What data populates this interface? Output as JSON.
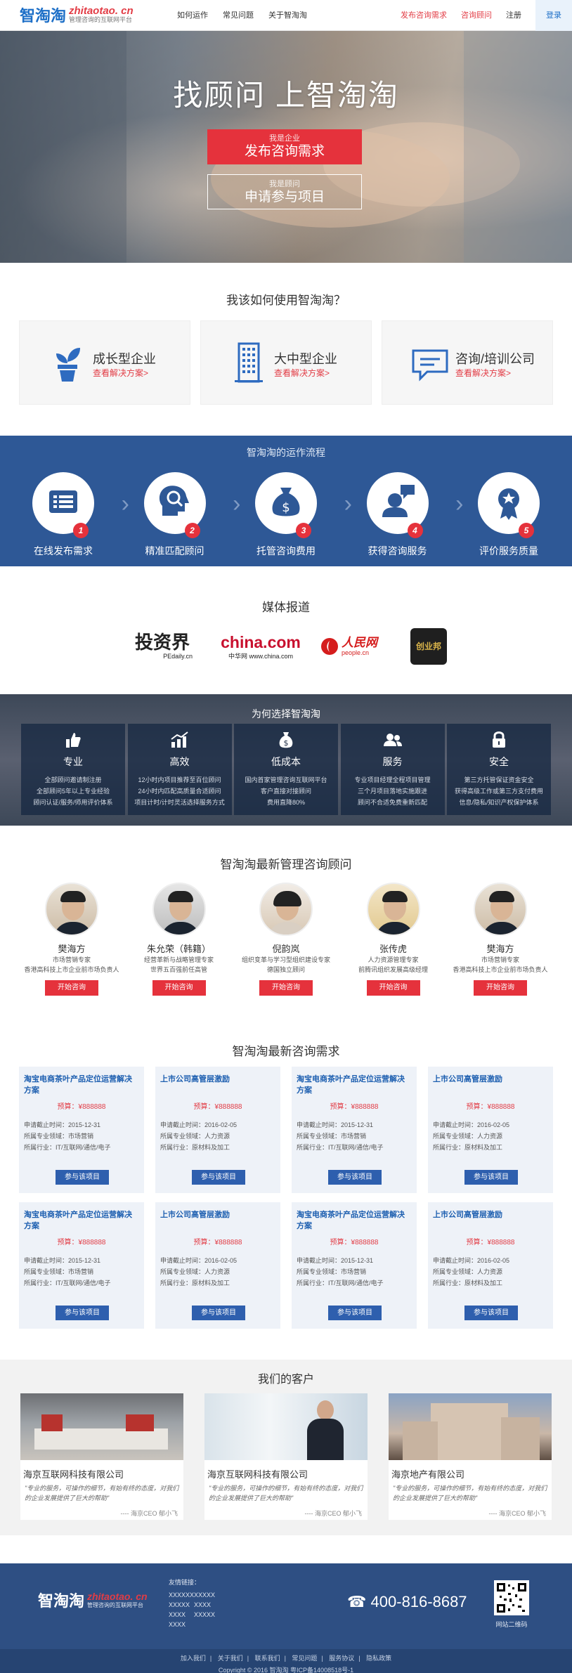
{
  "header": {
    "logo_cn": "智淘淘",
    "logo_url": "zhitaotao. cn",
    "logo_slogan": "管理咨询的互联网平台",
    "nav": [
      "如何运作",
      "常见问题",
      "关于智淘淘"
    ],
    "right_links": [
      "发布咨询需求",
      "咨询顾问",
      "注册"
    ],
    "login": "登录"
  },
  "hero": {
    "title": "找顾问  上智淘淘",
    "btn1_small": "我是企业",
    "btn1_large": "发布咨询需求",
    "btn2_small": "我是顾问",
    "btn2_large": "申请参与项目"
  },
  "usage": {
    "title": "我该如何使用智淘淘？",
    "cards": [
      {
        "title": "成长型企业",
        "link": "查看解决方案>",
        "icon": "plant-pot-icon"
      },
      {
        "title": "大中型企业",
        "link": "查看解决方案>",
        "icon": "building-icon"
      },
      {
        "title": "咨询/培训公司",
        "link": "查看解决方案>",
        "icon": "chat-bubble-icon"
      }
    ]
  },
  "flow": {
    "title": "智淘淘的运作流程",
    "steps": [
      {
        "label": "在线发布需求",
        "num": "1",
        "icon": "list-icon"
      },
      {
        "label": "精准匹配顾问",
        "num": "2",
        "icon": "head-search-icon"
      },
      {
        "label": "托管咨询费用",
        "num": "3",
        "icon": "money-bag-icon"
      },
      {
        "label": "获得咨询服务",
        "num": "4",
        "icon": "consultant-icon"
      },
      {
        "label": "评价服务质量",
        "num": "5",
        "icon": "award-icon"
      }
    ]
  },
  "media": {
    "title": "媒体报道",
    "logos": {
      "pedaily_main": "投资界",
      "pedaily_sub": "PEdaily.cn",
      "china_main": "china.com",
      "china_sub": "中华网  www.china.com",
      "people_main": "人民网",
      "people_sub": "people.cn",
      "chuangye": "创业邦"
    }
  },
  "why": {
    "title": "为何选择智淘淘",
    "items": [
      {
        "title": "专业",
        "lines": [
          "全部顾问邀请制注册",
          "全部顾问5年以上专业经验",
          "顾问认证/服务/师用评价体系"
        ],
        "icon": "thumb-up-icon"
      },
      {
        "title": "高效",
        "lines": [
          "12小时内项目推荐至百位顾问",
          "24小时内匹配高质量合适顾问",
          "项目计时/计时灵活选择服务方式"
        ],
        "icon": "chart-up-icon"
      },
      {
        "title": "低成本",
        "lines": [
          "国内首家管理咨询互联网平台",
          "客户直接对接顾问",
          "费用直降80%"
        ],
        "icon": "money-bag-icon"
      },
      {
        "title": "服务",
        "lines": [
          "专业项目经理全程项目管理",
          "三个月项目落地实施跟进",
          "顾问不合适免费重新匹配"
        ],
        "icon": "people-icon"
      },
      {
        "title": "安全",
        "lines": [
          "第三方托管保证资金安全",
          "获得高级工作或第三方支付费用",
          "信息/隐私/知识产权保护体系"
        ],
        "icon": "lock-icon"
      }
    ]
  },
  "consultants": {
    "title": "智淘淘最新管理咨询顾问",
    "items": [
      {
        "name": "樊海方",
        "r1": "市场营销专家",
        "r2": "香港高科技上市企业前市场负责人",
        "btn": "开始咨询"
      },
      {
        "name": "朱允荣（韩籍）",
        "r1": "经营革新与战略管理专家",
        "r2": "世界五百强前任高管",
        "btn": "开始咨询"
      },
      {
        "name": "倪韵岚",
        "r1": "组织变革与学习型组织建设专家",
        "r2": "德国独立顾问",
        "btn": "开始咨询"
      },
      {
        "name": "张传虎",
        "r1": "人力资源管理专家",
        "r2": "前腾讯组织发展高级经理",
        "btn": "开始咨询"
      },
      {
        "name": "樊海方",
        "r1": "市场营销专家",
        "r2": "香港高科技上市企业前市场负责人",
        "btn": "开始咨询"
      }
    ]
  },
  "demands": {
    "title": "智淘淘最新咨询需求",
    "items": [
      {
        "title": "淘宝电商茶叶产品定位运营解决方案",
        "budget": "预算：¥888888",
        "l1": "申请截止时间：2015-12-31",
        "l2": "所属专业领域：市场营销",
        "l3": "所属行业：IT/互联网/通信/电子",
        "btn": "参与该项目"
      },
      {
        "title": "上市公司高管层激励",
        "budget": "预算：¥888888",
        "l1": "申请截止时间：2016-02-05",
        "l2": "所属专业领域：人力资源",
        "l3": "所属行业：原材料及加工",
        "btn": "参与该项目"
      },
      {
        "title": "淘宝电商茶叶产品定位运营解决方案",
        "budget": "预算：¥888888",
        "l1": "申请截止时间：2015-12-31",
        "l2": "所属专业领域：市场营销",
        "l3": "所属行业：IT/互联网/通信/电子",
        "btn": "参与该项目"
      },
      {
        "title": "上市公司高管层激励",
        "budget": "预算：¥888888",
        "l1": "申请截止时间：2016-02-05",
        "l2": "所属专业领域：人力资源",
        "l3": "所属行业：原材料及加工",
        "btn": "参与该项目"
      },
      {
        "title": "淘宝电商茶叶产品定位运营解决方案",
        "budget": "预算：¥888888",
        "l1": "申请截止时间：2015-12-31",
        "l2": "所属专业领域：市场营销",
        "l3": "所属行业：IT/互联网/通信/电子",
        "btn": "参与该项目"
      },
      {
        "title": "上市公司高管层激励",
        "budget": "预算：¥888888",
        "l1": "申请截止时间：2016-02-05",
        "l2": "所属专业领域：人力资源",
        "l3": "所属行业：原材料及加工",
        "btn": "参与该项目"
      },
      {
        "title": "淘宝电商茶叶产品定位运营解决方案",
        "budget": "预算：¥888888",
        "l1": "申请截止时间：2015-12-31",
        "l2": "所属专业领域：市场营销",
        "l3": "所属行业：IT/互联网/通信/电子",
        "btn": "参与该项目"
      },
      {
        "title": "上市公司高管层激励",
        "budget": "预算：¥888888",
        "l1": "申请截止时间：2016-02-05",
        "l2": "所属专业领域：人力资源",
        "l3": "所属行业：原材料及加工",
        "btn": "参与该项目"
      }
    ]
  },
  "clients": {
    "title": "我们的客户",
    "items": [
      {
        "name": "海京互联网科技有限公司",
        "quote": "\"专业的服务，可操作的细节，有始有终的态度，对我们的企业发展提供了巨大的帮助\"",
        "sign": "---- 海京CEO  郁小飞"
      },
      {
        "name": "海京互联网科技有限公司",
        "quote": "\"专业的服务，可操作的细节，有始有终的态度，对我们的企业发展提供了巨大的帮助\"",
        "sign": "---- 海京CEO  郁小飞"
      },
      {
        "name": "海京地产有限公司",
        "quote": "\"专业的服务，可操作的细节，有始有终的态度，对我们的企业发展提供了巨大的帮助\"",
        "sign": "---- 海京CEO  郁小飞"
      }
    ]
  },
  "footer": {
    "logo_cn": "智淘淘",
    "logo_url": "zhitaotao. cn",
    "logo_slogan": "管理咨询的互联网平台",
    "links_title": "友情链接：",
    "links": [
      "XXXXXX",
      "XXXXX",
      "XXXXX",
      "XXXX",
      "XXXX",
      "XXXXX",
      "XXXX"
    ],
    "phone": "400-816-8687",
    "qr_label": "网站二维码",
    "bottom_links": [
      "加入我们",
      "关于我们",
      "联系我们",
      "常见问题",
      "服务协议",
      "隐私政策"
    ],
    "copyright": "Copyright © 2016 智淘淘 粤ICP备14008518号-1"
  }
}
